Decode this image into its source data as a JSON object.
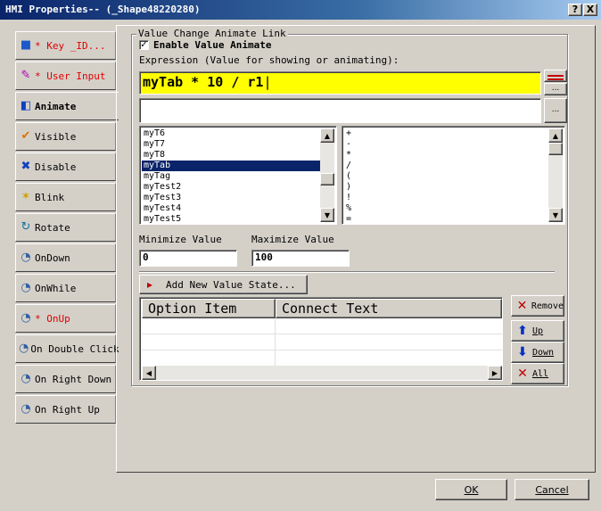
{
  "window": {
    "title": "HMI Properties-- (_Shape48220280)",
    "help_label": "?",
    "close_label": "X"
  },
  "tabs": [
    {
      "label": "* Key _ID...",
      "icon": "cube-icon",
      "red": true
    },
    {
      "label": "* User Input",
      "icon": "input-pen-icon",
      "red": true
    },
    {
      "label": "Animate",
      "icon": "animate-icon",
      "active": true
    },
    {
      "label": "Visible",
      "icon": "checkmark-icon"
    },
    {
      "label": "Disable",
      "icon": "cross-icon"
    },
    {
      "label": "Blink",
      "icon": "star-icon"
    },
    {
      "label": "Rotate",
      "icon": "rotate-icon"
    },
    {
      "label": "OnDown",
      "icon": "script-icon"
    },
    {
      "label": "OnWhile",
      "icon": "script-icon"
    },
    {
      "label": "* OnUp",
      "icon": "script-icon",
      "red": true
    },
    {
      "label": "On Double Click",
      "icon": "script-icon"
    },
    {
      "label": "On Right Down",
      "icon": "script-icon"
    },
    {
      "label": "On Right Up",
      "icon": "script-icon"
    }
  ],
  "group": {
    "title": "Value Change Animate Link",
    "enable_label": "Enable Value Animate",
    "enable_checked": true,
    "expression_label": "Expression (Value for showing or animating):",
    "expression_value": "myTab * 10 / r1",
    "second_expression_value": "",
    "ellipsis": "...",
    "variables": [
      "myT6",
      "myT7",
      "myT8",
      "myTab",
      "myTag",
      "myTest2",
      "myTest3",
      "myTest4",
      "myTest5"
    ],
    "selected_variable": "myTab",
    "operators": [
      "+",
      "-",
      "*",
      "/",
      "(",
      ")",
      "!",
      "%",
      "="
    ],
    "min_label": "Minimize Value",
    "min_value": "0",
    "max_label": "Maximize Value",
    "max_value": "100",
    "add_state_label": "Add New Value State...",
    "table_headers": [
      "Option Item",
      "Connect Text"
    ]
  },
  "side_buttons": {
    "remove": "Remove",
    "up": "Up",
    "down": "Down",
    "all": "All"
  },
  "footer": {
    "ok": "OK",
    "cancel": "Cancel"
  }
}
